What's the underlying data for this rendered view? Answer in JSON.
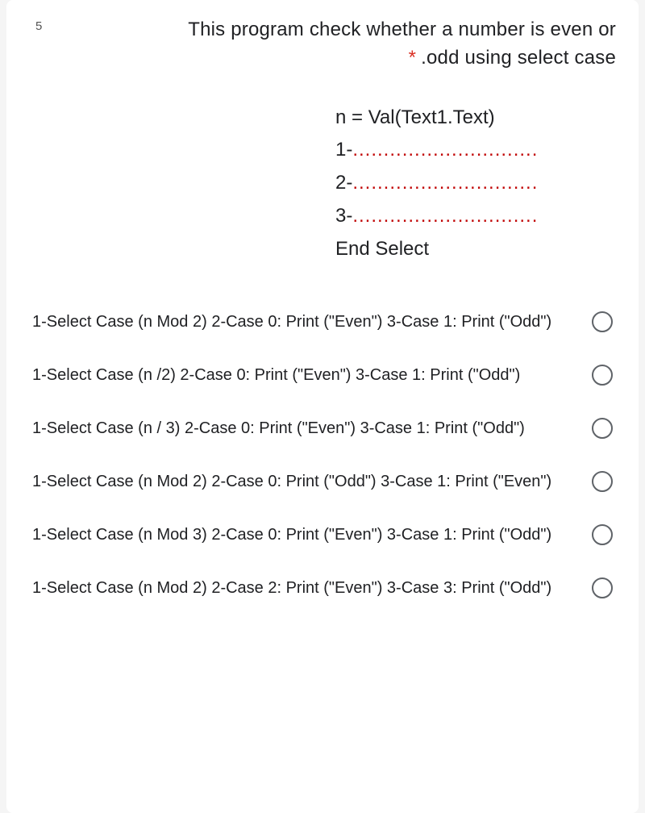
{
  "question": {
    "number_prefix": "",
    "number": "5",
    "title_line1": "This program check whether a number is even or",
    "title_line2": ".odd using select case",
    "required_mark": "*"
  },
  "code": {
    "l0": "n = Val(Text1.Text)",
    "l1_prefix": "1-",
    "l2_prefix": "2-",
    "l3_prefix": "3-",
    "dots": "..............................",
    "l4": "End Select"
  },
  "options": [
    {
      "text": "1-Select Case (n Mod 2) 2-Case 0: Print (\"Even\") 3-Case 1: Print (\"Odd\")"
    },
    {
      "text": "1-Select Case (n /2) 2-Case 0: Print (\"Even\") 3-Case 1: Print (\"Odd\")"
    },
    {
      "text": "1-Select Case (n / 3) 2-Case 0: Print (\"Even\") 3-Case 1: Print (\"Odd\")"
    },
    {
      "text": "1-Select Case (n Mod 2) 2-Case 0: Print (\"Odd\") 3-Case 1: Print (\"Even\")"
    },
    {
      "text": "1-Select Case (n Mod 3) 2-Case 0: Print (\"Even\") 3-Case 1: Print (\"Odd\")"
    },
    {
      "text": "1-Select Case (n Mod 2) 2-Case 2: Print (\"Even\") 3-Case 3: Print (\"Odd\")"
    }
  ]
}
